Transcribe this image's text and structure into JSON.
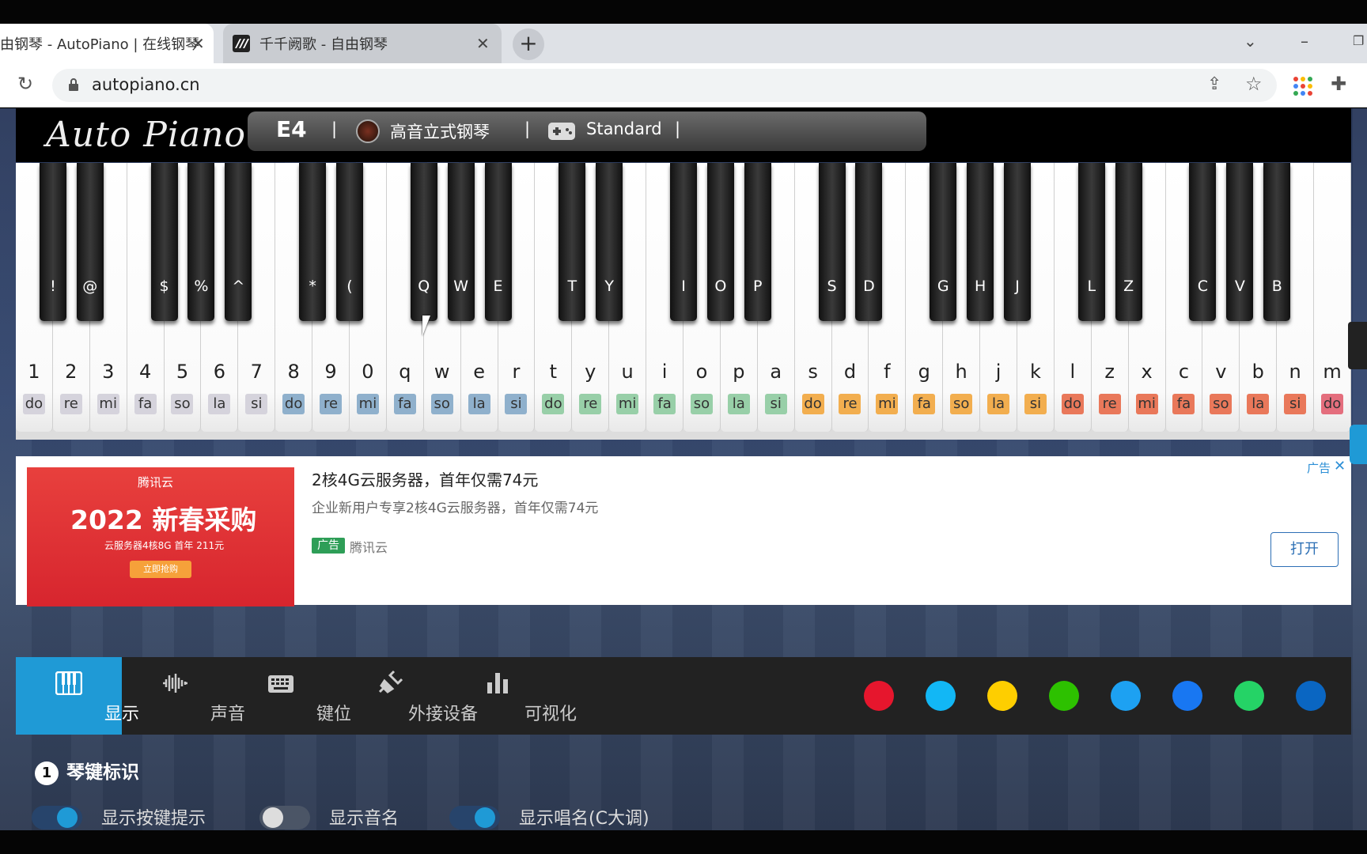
{
  "browser": {
    "tabs": [
      {
        "title": "由钢琴 - AutoPiano | 在线钢琴",
        "close": "✕"
      },
      {
        "title": "千千阙歌 - 自由钢琴",
        "close": "✕"
      }
    ],
    "new_tab": "+",
    "url": "autopiano.cn"
  },
  "piano_header": {
    "logo": "Auto Piano",
    "note": "E4",
    "sep": "|",
    "instrument": "高音立式钢琴",
    "mode": "Standard"
  },
  "white_keys": [
    {
      "key": "1",
      "solfege": "do",
      "group": 0
    },
    {
      "key": "2",
      "solfege": "re",
      "group": 0
    },
    {
      "key": "3",
      "solfege": "mi",
      "group": 0
    },
    {
      "key": "4",
      "solfege": "fa",
      "group": 0
    },
    {
      "key": "5",
      "solfege": "so",
      "group": 0
    },
    {
      "key": "6",
      "solfege": "la",
      "group": 0
    },
    {
      "key": "7",
      "solfege": "si",
      "group": 0
    },
    {
      "key": "8",
      "solfege": "do",
      "group": 1
    },
    {
      "key": "9",
      "solfege": "re",
      "group": 1
    },
    {
      "key": "0",
      "solfege": "mi",
      "group": 1
    },
    {
      "key": "q",
      "solfege": "fa",
      "group": 1
    },
    {
      "key": "w",
      "solfege": "so",
      "group": 1
    },
    {
      "key": "e",
      "solfege": "la",
      "group": 1
    },
    {
      "key": "r",
      "solfege": "si",
      "group": 1
    },
    {
      "key": "t",
      "solfege": "do",
      "group": 2
    },
    {
      "key": "y",
      "solfege": "re",
      "group": 2
    },
    {
      "key": "u",
      "solfege": "mi",
      "group": 2
    },
    {
      "key": "i",
      "solfege": "fa",
      "group": 2
    },
    {
      "key": "o",
      "solfege": "so",
      "group": 2
    },
    {
      "key": "p",
      "solfege": "la",
      "group": 2
    },
    {
      "key": "a",
      "solfege": "si",
      "group": 2
    },
    {
      "key": "s",
      "solfege": "do",
      "group": 3
    },
    {
      "key": "d",
      "solfege": "re",
      "group": 3
    },
    {
      "key": "f",
      "solfege": "mi",
      "group": 3
    },
    {
      "key": "g",
      "solfege": "fa",
      "group": 3
    },
    {
      "key": "h",
      "solfege": "so",
      "group": 3
    },
    {
      "key": "j",
      "solfege": "la",
      "group": 3
    },
    {
      "key": "k",
      "solfege": "si",
      "group": 3
    },
    {
      "key": "l",
      "solfege": "do",
      "group": 4
    },
    {
      "key": "z",
      "solfege": "re",
      "group": 4
    },
    {
      "key": "x",
      "solfege": "mi",
      "group": 4
    },
    {
      "key": "c",
      "solfege": "fa",
      "group": 4
    },
    {
      "key": "v",
      "solfege": "so",
      "group": 4
    },
    {
      "key": "b",
      "solfege": "la",
      "group": 4
    },
    {
      "key": "n",
      "solfege": "si",
      "group": 4
    },
    {
      "key": "m",
      "solfege": "do",
      "group": 5
    }
  ],
  "black_keys": [
    {
      "key": "!",
      "after": 0
    },
    {
      "key": "@",
      "after": 1
    },
    {
      "key": "$",
      "after": 3
    },
    {
      "key": "%",
      "after": 4
    },
    {
      "key": "^",
      "after": 5
    },
    {
      "key": "*",
      "after": 7
    },
    {
      "key": "(",
      "after": 8
    },
    {
      "key": "Q",
      "after": 10
    },
    {
      "key": "W",
      "after": 11
    },
    {
      "key": "E",
      "after": 12
    },
    {
      "key": "T",
      "after": 14
    },
    {
      "key": "Y",
      "after": 15
    },
    {
      "key": "I",
      "after": 17
    },
    {
      "key": "O",
      "after": 18
    },
    {
      "key": "P",
      "after": 19
    },
    {
      "key": "S",
      "after": 21
    },
    {
      "key": "D",
      "after": 22
    },
    {
      "key": "G",
      "after": 24
    },
    {
      "key": "H",
      "after": 25
    },
    {
      "key": "J",
      "after": 26
    },
    {
      "key": "L",
      "after": 28
    },
    {
      "key": "Z",
      "after": 29
    },
    {
      "key": "C",
      "after": 31
    },
    {
      "key": "V",
      "after": 32
    },
    {
      "key": "B",
      "after": 33
    }
  ],
  "group_colors": [
    "#d5d3dc",
    "#8fb0cc",
    "#98cfa8",
    "#f2ae4f",
    "#e9785a",
    "#e46e7d"
  ],
  "ad": {
    "image_brand": "腾讯云",
    "image_headline": "2022 新春采购",
    "image_detail": "云服务器4核8G 首年 211元",
    "image_button": "立即抢购",
    "title": "2核4G云服务器，首年仅需74元",
    "subtitle": "企业新用户专享2核4G云服务器，首年仅需74元",
    "tag": "广告",
    "source": "腾讯云",
    "label": "广告",
    "close": "✕",
    "open": "打开"
  },
  "toolbar": {
    "items": [
      {
        "label": "显示",
        "active": true,
        "icon": "piano-icon"
      },
      {
        "label": "声音",
        "active": false,
        "icon": "waveform-icon"
      },
      {
        "label": "键位",
        "active": false,
        "icon": "keyboard-icon"
      },
      {
        "label": "外接设备",
        "active": false,
        "icon": "plug-icon"
      },
      {
        "label": "可视化",
        "active": false,
        "icon": "bar-chart-icon"
      }
    ],
    "social": [
      {
        "name": "weibo-icon",
        "color": "#e6162d"
      },
      {
        "name": "qq-icon",
        "color": "#12b7f5"
      },
      {
        "name": "qzone-icon",
        "color": "#fece00"
      },
      {
        "name": "wechat-icon",
        "color": "#2dc100"
      },
      {
        "name": "twitter-icon",
        "color": "#1da1f2"
      },
      {
        "name": "facebook-icon",
        "color": "#1877f2"
      },
      {
        "name": "whatsapp-icon",
        "color": "#25d366"
      },
      {
        "name": "linkedin-icon",
        "color": "#0a66c2"
      }
    ]
  },
  "section": {
    "number": "1",
    "title": "琴键标识",
    "options": [
      {
        "label": "显示按键提示",
        "on": true
      },
      {
        "label": "显示音名",
        "on": false
      },
      {
        "label": "显示唱名(C大调)",
        "on": true
      }
    ]
  }
}
